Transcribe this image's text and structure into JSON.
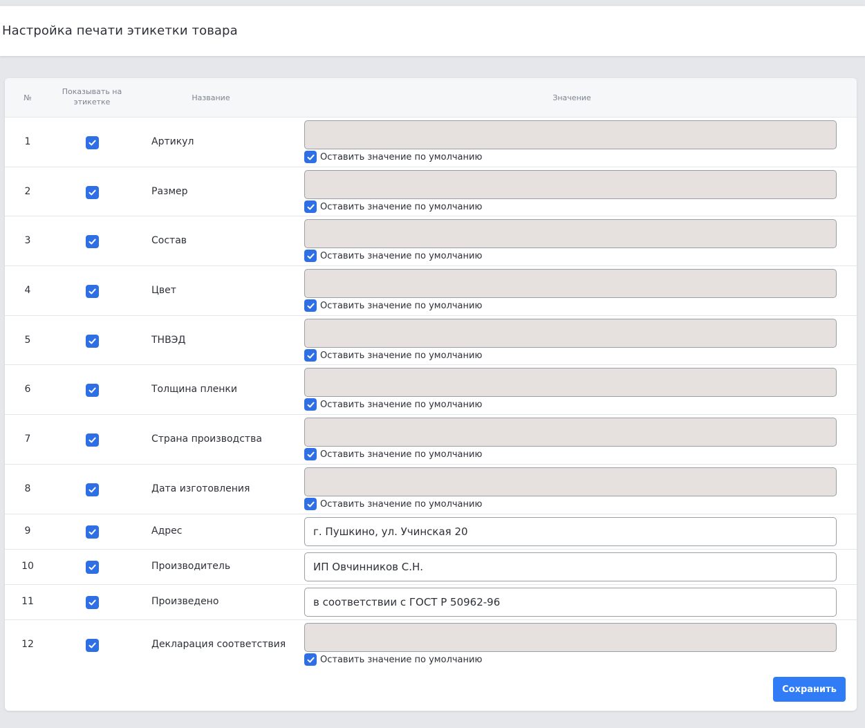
{
  "page": {
    "title": "Настройка печати этикетки товара"
  },
  "table": {
    "headers": {
      "num": "№",
      "show": "Показывать на этикетке",
      "name": "Название",
      "value": "Значение"
    },
    "default_label": "Оставить значение по умолчанию",
    "rows": [
      {
        "num": "1",
        "name": "Артикул",
        "value": "",
        "show": true,
        "use_default": true
      },
      {
        "num": "2",
        "name": "Размер",
        "value": "",
        "show": true,
        "use_default": true
      },
      {
        "num": "3",
        "name": "Состав",
        "value": "",
        "show": true,
        "use_default": true
      },
      {
        "num": "4",
        "name": "Цвет",
        "value": "",
        "show": true,
        "use_default": true
      },
      {
        "num": "5",
        "name": "ТНВЭД",
        "value": "",
        "show": true,
        "use_default": true
      },
      {
        "num": "6",
        "name": "Толщина пленки",
        "value": "",
        "show": true,
        "use_default": true
      },
      {
        "num": "7",
        "name": "Страна производства",
        "value": "",
        "show": true,
        "use_default": true
      },
      {
        "num": "8",
        "name": "Дата изготовления",
        "value": "",
        "show": true,
        "use_default": true
      },
      {
        "num": "9",
        "name": "Адрес",
        "value": "г. Пушкино, ул. Учинская 20",
        "show": true,
        "use_default": false
      },
      {
        "num": "10",
        "name": "Производитель",
        "value": "ИП Овчинников С.Н.",
        "show": true,
        "use_default": false
      },
      {
        "num": "11",
        "name": "Произведено",
        "value": "в соответствии с ГОСТ Р 50962-96",
        "show": true,
        "use_default": false
      },
      {
        "num": "12",
        "name": "Декларация соответствия",
        "value": "",
        "show": true,
        "use_default": true
      }
    ]
  },
  "actions": {
    "save_label": "Сохранить"
  },
  "colors": {
    "accent": "#2f7cf6",
    "checkbox": "#2f6fe5",
    "disabled_input": "#e6e0df"
  },
  "icons": {
    "checkbox": "check-icon"
  }
}
